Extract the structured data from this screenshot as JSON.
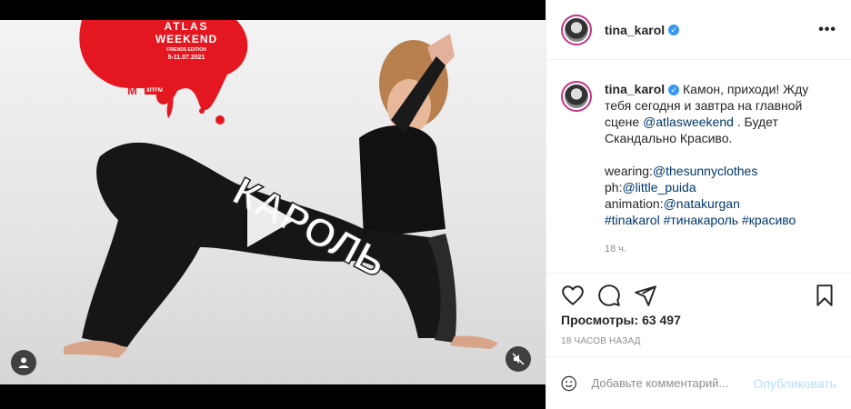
{
  "media": {
    "poster": {
      "festival_line1": "ATLAS",
      "festival_line2": "WEEKEND",
      "edition": "FRIENDS EDITION",
      "dates": "5-11.07.2021",
      "radio": "ХІТFM",
      "big_text": "КАРОЛЬ"
    },
    "colors": {
      "blood_red": "#e4161f",
      "backdrop": "#e8e8e8"
    }
  },
  "header": {
    "username": "tina_karol",
    "more_label": "•••"
  },
  "caption": {
    "username": "tina_karol",
    "text_before_mention": "Камон, приходи! Жду тебя сегодня и завтра на главной сцене ",
    "mention_atlas": "@atlasweekend",
    "text_after_mention": " .  Будет Скандально Красиво.",
    "wearing_label": "wearing:",
    "wearing_mention": "@thesunnyclothes",
    "ph_label": "ph:",
    "ph_mention": "@little_puida",
    "animation_label": "animation:",
    "animation_mention": "@natakurgan",
    "hashtag1": "#tinakarol",
    "hashtag2": "#тинакароль",
    "hashtag3": "#красиво",
    "time_ago": "18 ч."
  },
  "stats": {
    "views_label": "Просмотры:",
    "views_value": "63 497",
    "posted_ago": "18 ЧАСОВ НАЗАД"
  },
  "comment": {
    "placeholder": "Добавьте комментарий...",
    "publish_label": "Опубликовать"
  }
}
